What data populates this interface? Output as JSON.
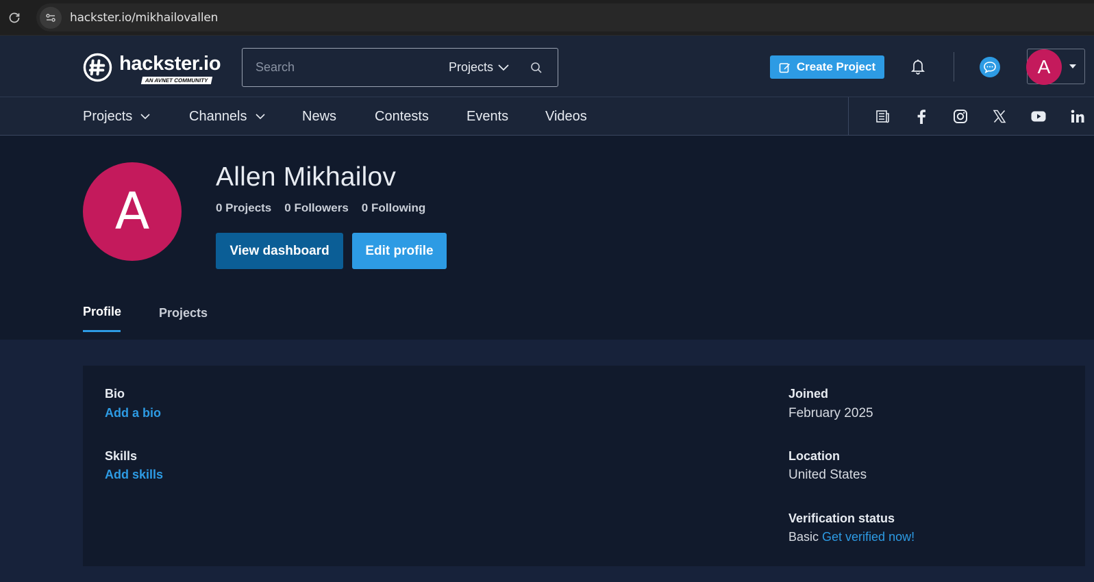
{
  "browser": {
    "url": "hackster.io/mikhailovallen"
  },
  "header": {
    "logo_text": "hackster.io",
    "logo_badge": "AN AVNET COMMUNITY",
    "search": {
      "placeholder": "Search",
      "scope": "Projects"
    },
    "create_button": "Create Project",
    "user_initial": "A"
  },
  "nav": {
    "items": [
      {
        "label": "Projects",
        "has_dropdown": true
      },
      {
        "label": "Channels",
        "has_dropdown": true
      },
      {
        "label": "News",
        "has_dropdown": false
      },
      {
        "label": "Contests",
        "has_dropdown": false
      },
      {
        "label": "Events",
        "has_dropdown": false
      },
      {
        "label": "Videos",
        "has_dropdown": false
      }
    ],
    "social_icons": [
      "newsletter-icon",
      "facebook-icon",
      "instagram-icon",
      "x-icon",
      "youtube-icon",
      "linkedin-icon"
    ]
  },
  "profile": {
    "initial": "A",
    "name": "Allen Mikhailov",
    "stats": {
      "projects": "0 Projects",
      "followers": "0 Followers",
      "following": "0 Following"
    },
    "buttons": {
      "dashboard": "View dashboard",
      "edit": "Edit profile"
    },
    "tabs": [
      "Profile",
      "Projects"
    ],
    "active_tab": "Profile"
  },
  "details": {
    "bio_label": "Bio",
    "bio_link": "Add a bio",
    "skills_label": "Skills",
    "skills_link": "Add skills",
    "joined_label": "Joined",
    "joined_value": "February 2025",
    "location_label": "Location",
    "location_value": "United States",
    "verification_label": "Verification status",
    "verification_value": "Basic",
    "verification_link": "Get verified now!"
  },
  "colors": {
    "accent": "#2d9be4",
    "avatar": "#c41a5c",
    "dashboard_button": "#0b5e96",
    "page_bg": "#111a2c"
  }
}
